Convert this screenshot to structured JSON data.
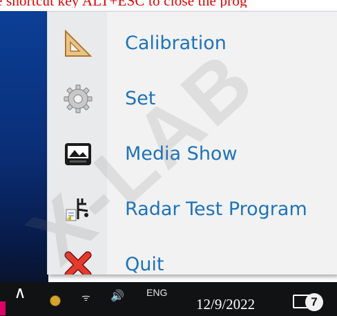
{
  "banner": {
    "text": "e shortcut key ALT+ESC to close the prog"
  },
  "menu": {
    "items": [
      {
        "label": "Calibration",
        "icon": "set-square-icon"
      },
      {
        "label": "Set",
        "icon": "gear-icon"
      },
      {
        "label": "Media Show",
        "icon": "media-display-icon"
      },
      {
        "label": "Radar Test Program",
        "icon": "radar-test-icon"
      },
      {
        "label": "Quit",
        "icon": "red-x-icon"
      }
    ],
    "label_color": "#1e73b8"
  },
  "taskbar": {
    "chevron": "∧",
    "wifi": "ᯤ",
    "volume": "🔊",
    "lang": "ENG",
    "date": "12/9/2022",
    "notification_count": "7"
  },
  "watermark": {
    "text": "X-LAB"
  }
}
